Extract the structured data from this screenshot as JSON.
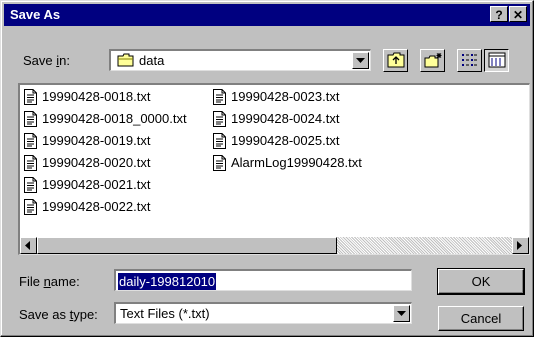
{
  "window": {
    "title": "Save As",
    "help_btn": "?",
    "close_btn": "✕"
  },
  "save_in": {
    "label_pre": "Save ",
    "label_acc": "i",
    "label_post": "n:",
    "value": "data"
  },
  "files_col1": [
    "19990428-0018.txt",
    "19990428-0018_0000.txt",
    "19990428-0019.txt",
    "19990428-0020.txt",
    "19990428-0021.txt",
    "19990428-0022.txt"
  ],
  "files_col2": [
    "19990428-0023.txt",
    "19990428-0024.txt",
    "19990428-0025.txt",
    "AlarmLog19990428.txt"
  ],
  "file_name": {
    "label_pre": "File ",
    "label_acc": "n",
    "label_post": "ame:",
    "value": "daily-199812010"
  },
  "save_type": {
    "label_pre": "Save as ",
    "label_acc": "t",
    "label_post": "ype:",
    "value": "Text Files (*.txt)"
  },
  "buttons": {
    "ok": "OK",
    "cancel": "Cancel"
  },
  "colors": {
    "title_bg": "#000080",
    "face": "#c0c0c0",
    "selection": "#000080"
  }
}
